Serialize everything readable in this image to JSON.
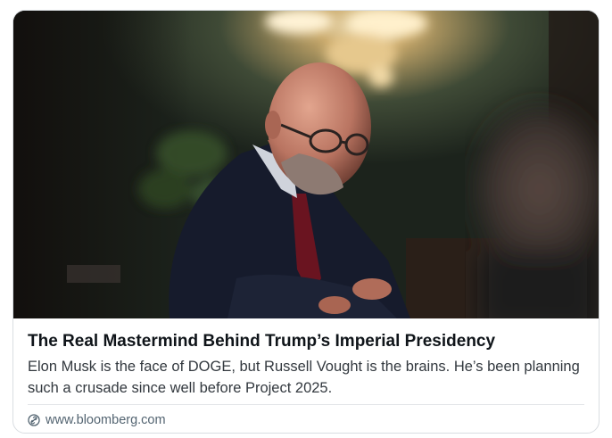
{
  "link_card": {
    "image": {
      "description_icon": "photo"
    },
    "title": "The Real Mastermind Behind Trump’s Imperial Presidency",
    "description": "Elon Musk is the face of DOGE, but Russell Vought is the brains. He’s been planning such a crusade since well before Project 2025.",
    "source": {
      "icon": "link-icon",
      "domain": "www.bloomberg.com"
    }
  },
  "colors": {
    "title": "#0f1419",
    "description": "#33393f",
    "source": "#536471",
    "border": "#d9dde1"
  }
}
